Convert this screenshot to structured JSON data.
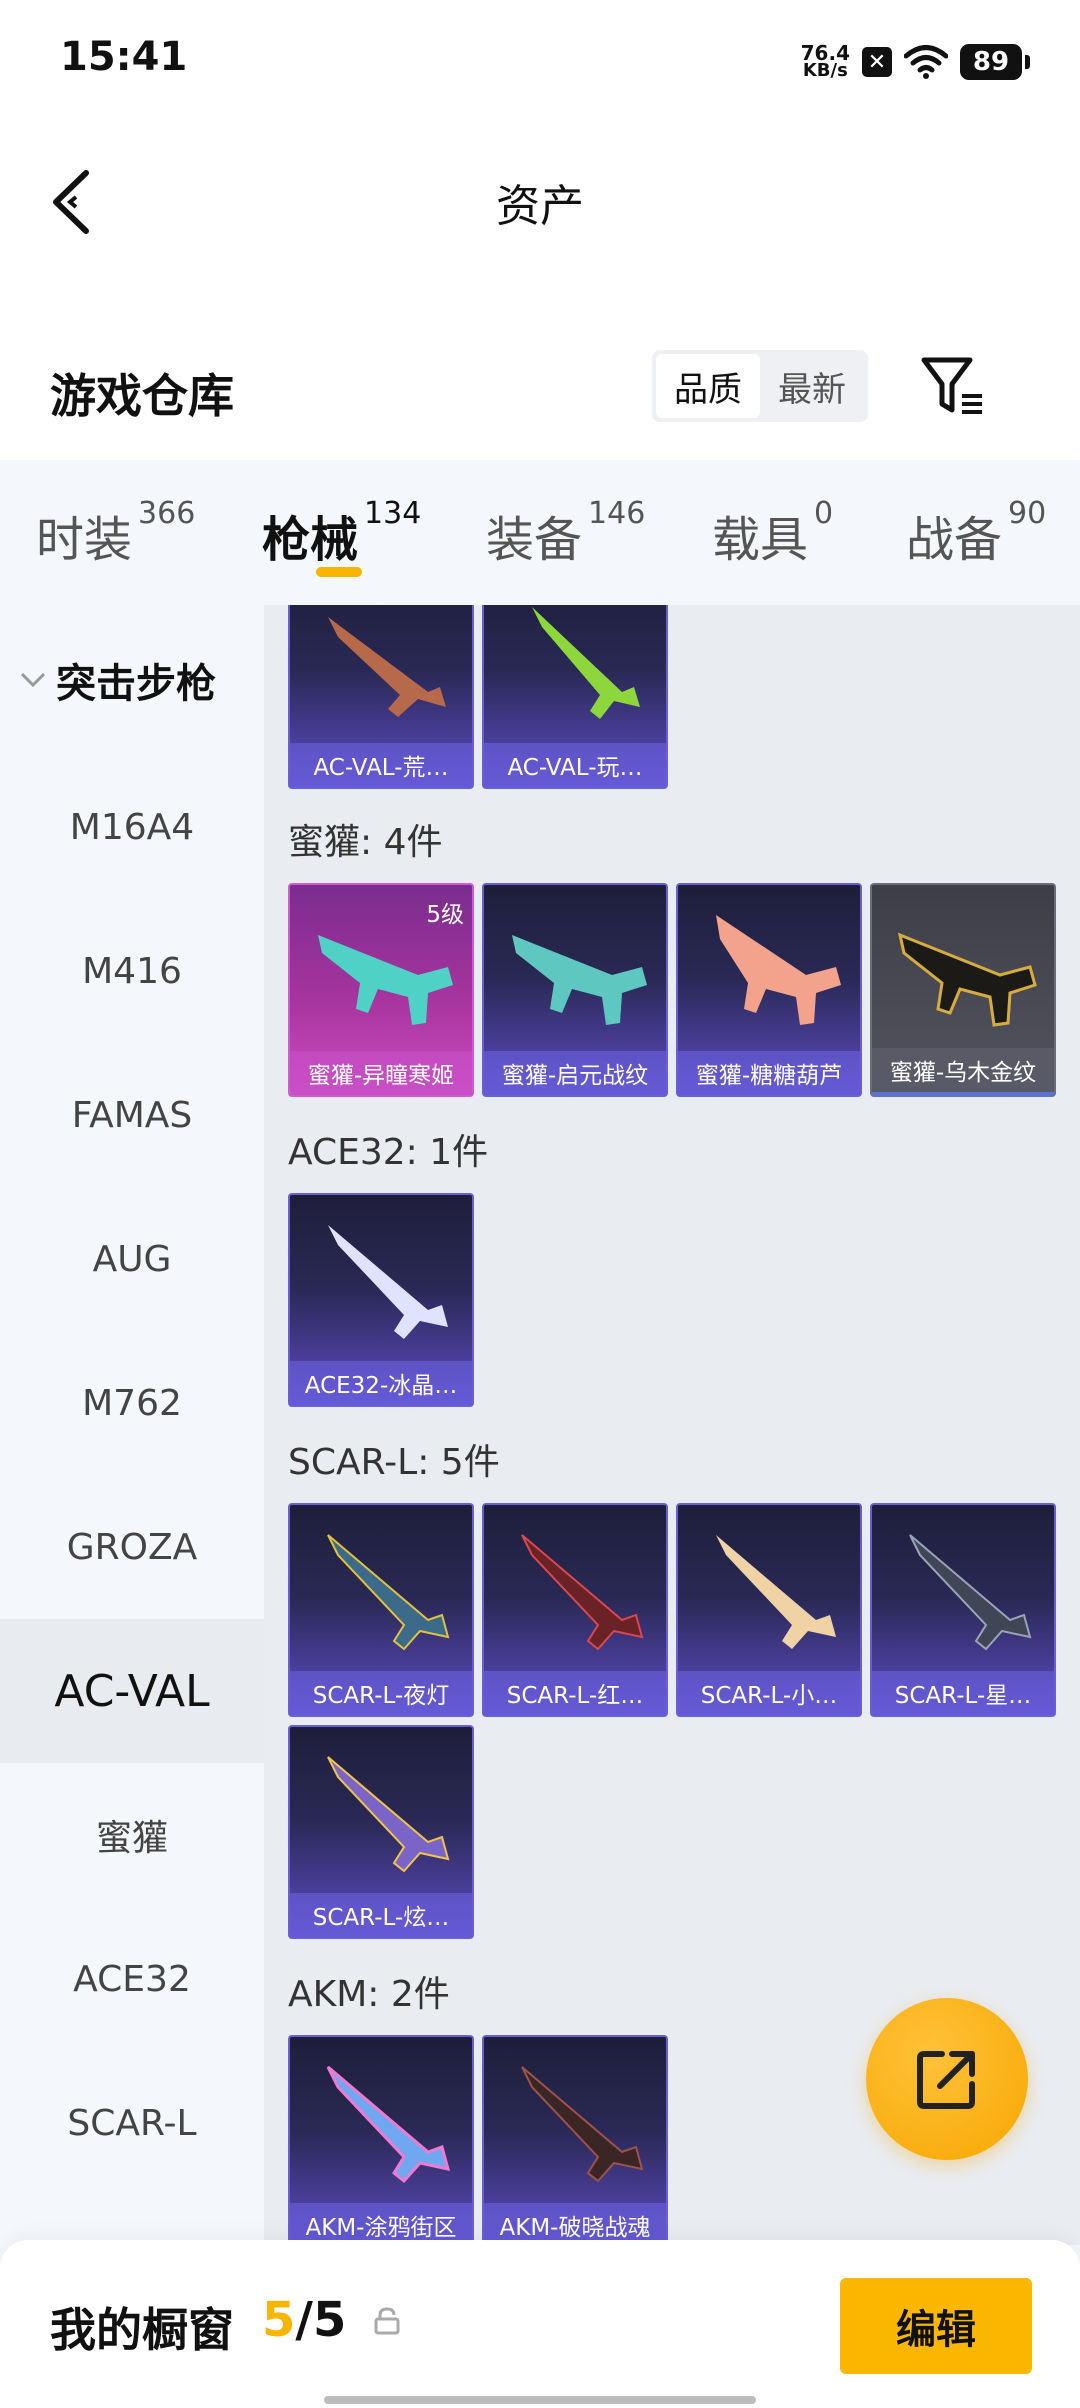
{
  "status_bar": {
    "time": "15:41",
    "net_speed_value": "76.4",
    "net_speed_unit": "KB/s",
    "battery": "89"
  },
  "header": {
    "title": "资产"
  },
  "section": {
    "title": "游戏仓库",
    "sort_options": [
      "品质",
      "最新"
    ],
    "active_sort": "品质"
  },
  "tabs": [
    {
      "label": "时装",
      "count": "366"
    },
    {
      "label": "枪械",
      "count": "134"
    },
    {
      "label": "装备",
      "count": "146"
    },
    {
      "label": "载具",
      "count": "0"
    },
    {
      "label": "战备",
      "count": "90"
    }
  ],
  "active_tab": "枪械",
  "sidebar": {
    "group": "突击步枪",
    "items": [
      "M16A4",
      "M416",
      "FAMAS",
      "AUG",
      "M762",
      "GROZA",
      "AC-VAL",
      "蜜獾",
      "ACE32",
      "SCAR-L"
    ],
    "active": "AC-VAL"
  },
  "content": {
    "acval_cards": [
      "AC-VAL-荒…",
      "AC-VAL-玩…"
    ],
    "groups": [
      {
        "label": "蜜獾: 4件",
        "cards": [
          "蜜獾-异瞳寒姬",
          "蜜獾-启元战纹",
          "蜜獾-糖糖葫芦",
          "蜜獾-乌木金纹"
        ],
        "level_badge": "5级"
      },
      {
        "label": "ACE32: 1件",
        "cards": [
          "ACE32-冰晶…"
        ]
      },
      {
        "label": "SCAR-L: 5件",
        "cards": [
          "SCAR-L-夜灯",
          "SCAR-L-红…",
          "SCAR-L-小…",
          "SCAR-L-星…",
          "SCAR-L-炫…"
        ]
      },
      {
        "label": "AKM: 2件",
        "cards": [
          "AKM-涂鸦街区",
          "AKM-破晓战魂"
        ]
      }
    ]
  },
  "bottom_bar": {
    "label": "我的橱窗",
    "count_current": "5",
    "count_total": "/5",
    "edit_label": "编辑"
  },
  "colors": {
    "accent": "#f7b500",
    "card_purple": "#5b4fc4",
    "card_pink": "#c94fc0"
  }
}
